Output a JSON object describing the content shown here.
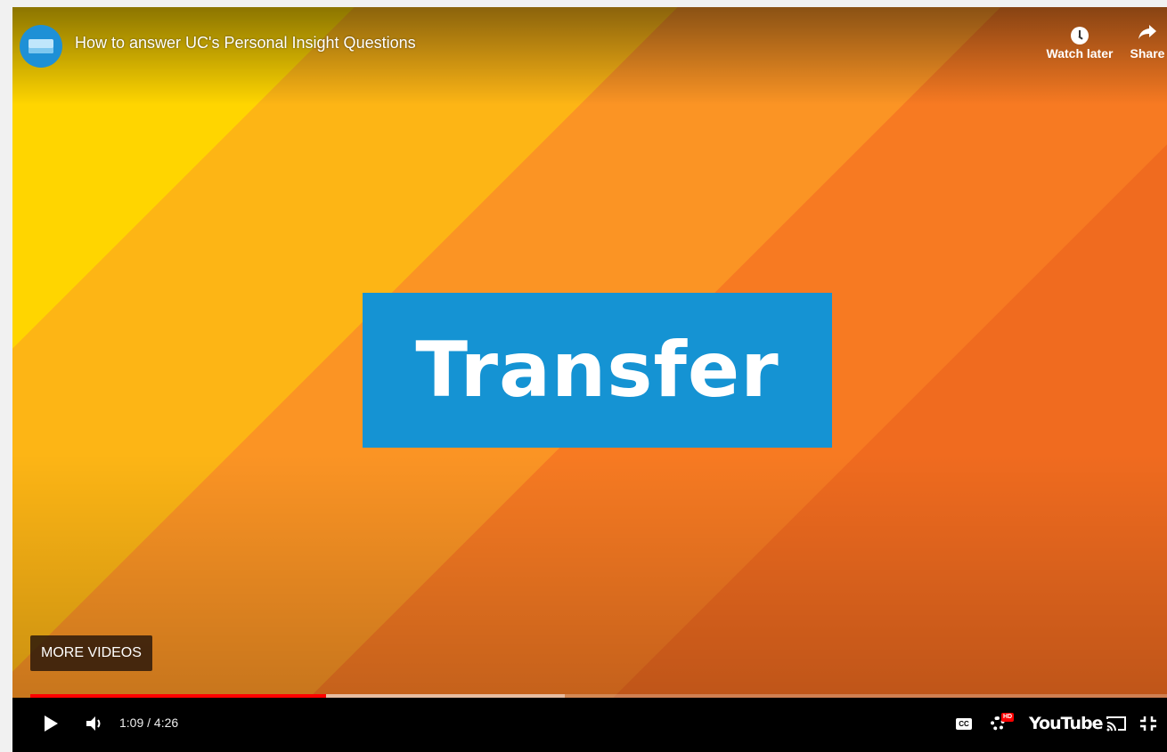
{
  "video": {
    "title": "How to answer UC's Personal Insight Questions",
    "card_text": "Transfer"
  },
  "top_actions": {
    "watch_later": "Watch later",
    "share": "Share"
  },
  "overlay": {
    "more_videos": "MORE VIDEOS"
  },
  "controls": {
    "time": "1:09 / 4:26",
    "logo_text": "YouTube",
    "cc_label": "CC",
    "hd_badge": "HD",
    "progress_played_fraction": 0.26,
    "progress_loaded_fraction": 0.47
  },
  "colors": {
    "accent_red": "#ff0000",
    "card_blue": "#1593d3"
  },
  "icons": [
    "channel-avatar",
    "clock-icon",
    "share-arrow-icon",
    "play-icon",
    "volume-icon",
    "cc-icon",
    "settings-gear-icon",
    "youtube-logo",
    "cast-icon",
    "exit-fullscreen-icon"
  ]
}
